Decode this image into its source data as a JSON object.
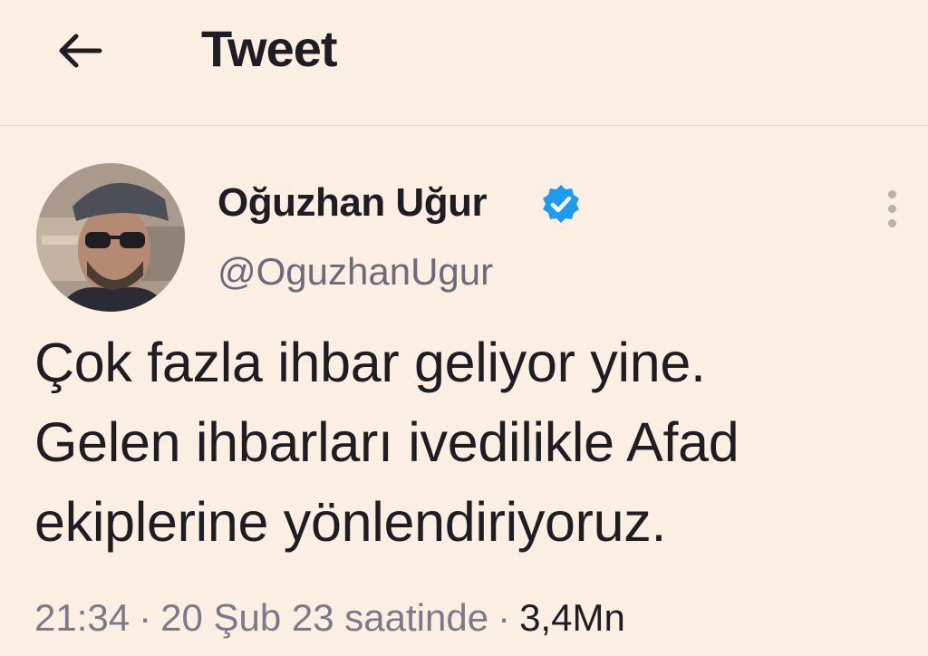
{
  "header": {
    "title": "Tweet",
    "back_icon": "arrow-left-icon"
  },
  "tweet": {
    "author": {
      "name": "Oğuzhan Uğur",
      "handle": "@OguzhanUgur",
      "verified": true,
      "verified_icon": "verified-badge-icon",
      "verified_color": "#1d9bf0"
    },
    "more_icon": "more-vertical-icon",
    "text_lines": [
      "Çok fazla ihbar geliyor yine.",
      "Gelen ihbarları ivedilikle Afad",
      "ekiplerine yönlendiriyoruz."
    ],
    "time": "21:34",
    "date": "20 Şub 23 saatinde",
    "separator": "·",
    "views": "3,4Mn"
  },
  "colors": {
    "background": "#fbeee2",
    "text": "#1f1d24",
    "muted": "#6b6b7b"
  }
}
